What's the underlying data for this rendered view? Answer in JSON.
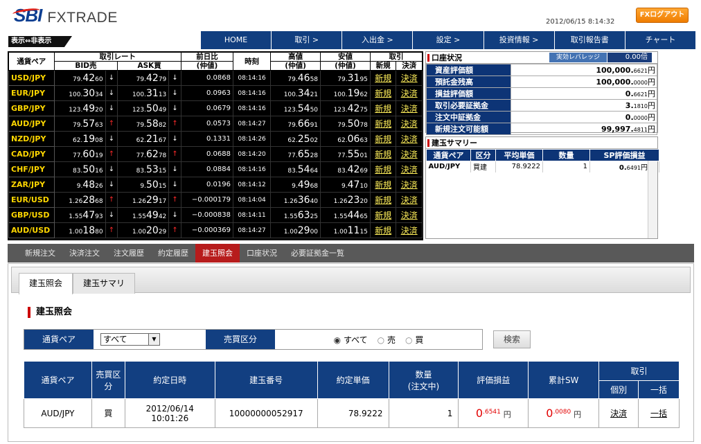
{
  "header": {
    "brand_sbi": "SBI",
    "brand_fx": "FXTRADE",
    "datetime": "2012/06/15 8:14:32",
    "logout": "FXログアウト",
    "toggle": "表示⇔非表示"
  },
  "nav": [
    "HOME",
    "取引 >",
    "入出金 >",
    "設定 >",
    "投資情報 >",
    "取引報告書",
    "チャート"
  ],
  "rates": {
    "headers": {
      "pair": "通貨ペア",
      "rate": "取引レート",
      "bid": "BID売",
      "ask": "ASK買",
      "change": "前日比",
      "change_sub": "(仲値)",
      "time": "時刻",
      "high": "高値",
      "high_sub": "(仲値)",
      "low": "安値",
      "low_sub": "(仲値)",
      "trade": "取引",
      "new": "新規",
      "settle": "決済"
    },
    "rows": [
      {
        "pair": "USD/JPY",
        "bid_a": "79.",
        "bid_b": "42",
        "bid_c": "60",
        "bid_dir": "down",
        "ask_a": "79.",
        "ask_b": "42",
        "ask_c": "79",
        "ask_dir": "down",
        "change": "0.0868",
        "time": "08:14:16",
        "high_a": "79.",
        "high_b": "46",
        "high_c": "58",
        "low_a": "79.",
        "low_b": "31",
        "low_c": "95",
        "new": "新規",
        "settle": "決済"
      },
      {
        "pair": "EUR/JPY",
        "bid_a": "100.",
        "bid_b": "30",
        "bid_c": "34",
        "bid_dir": "down",
        "ask_a": "100.",
        "ask_b": "31",
        "ask_c": "13",
        "ask_dir": "down",
        "change": "0.0963",
        "time": "08:14:16",
        "high_a": "100.",
        "high_b": "34",
        "high_c": "21",
        "low_a": "100.",
        "low_b": "19",
        "low_c": "62",
        "new": "新規",
        "settle": "決済"
      },
      {
        "pair": "GBP/JPY",
        "bid_a": "123.",
        "bid_b": "49",
        "bid_c": "20",
        "bid_dir": "down",
        "ask_a": "123.",
        "ask_b": "50",
        "ask_c": "49",
        "ask_dir": "down",
        "change": "0.0679",
        "time": "08:14:16",
        "high_a": "123.",
        "high_b": "54",
        "high_c": "50",
        "low_a": "123.",
        "low_b": "42",
        "low_c": "75",
        "new": "新規",
        "settle": "決済"
      },
      {
        "pair": "AUD/JPY",
        "bid_a": "79.",
        "bid_b": "57",
        "bid_c": "63",
        "bid_dir": "up",
        "ask_a": "79.",
        "ask_b": "58",
        "ask_c": "82",
        "ask_dir": "up",
        "change": "0.0573",
        "time": "08:14:27",
        "high_a": "79.",
        "high_b": "66",
        "high_c": "91",
        "low_a": "79.",
        "low_b": "50",
        "low_c": "78",
        "new": "新規",
        "settle": "決済"
      },
      {
        "pair": "NZD/JPY",
        "bid_a": "62.",
        "bid_b": "19",
        "bid_c": "08",
        "bid_dir": "down",
        "ask_a": "62.",
        "ask_b": "21",
        "ask_c": "67",
        "ask_dir": "down",
        "change": "0.1331",
        "time": "08:14:26",
        "high_a": "62.",
        "high_b": "25",
        "high_c": "02",
        "low_a": "62.",
        "low_b": "06",
        "low_c": "63",
        "new": "新規",
        "settle": "決済"
      },
      {
        "pair": "CAD/JPY",
        "bid_a": "77.",
        "bid_b": "60",
        "bid_c": "19",
        "bid_dir": "up",
        "ask_a": "77.",
        "ask_b": "62",
        "ask_c": "78",
        "ask_dir": "up",
        "change": "0.0688",
        "time": "08:14:20",
        "high_a": "77.",
        "high_b": "65",
        "high_c": "28",
        "low_a": "77.",
        "low_b": "55",
        "low_c": "01",
        "new": "新規",
        "settle": "決済"
      },
      {
        "pair": "CHF/JPY",
        "bid_a": "83.",
        "bid_b": "50",
        "bid_c": "16",
        "bid_dir": "down",
        "ask_a": "83.",
        "ask_b": "53",
        "ask_c": "15",
        "ask_dir": "down",
        "change": "0.0884",
        "time": "08:14:16",
        "high_a": "83.",
        "high_b": "54",
        "high_c": "64",
        "low_a": "83.",
        "low_b": "42",
        "low_c": "69",
        "new": "新規",
        "settle": "決済"
      },
      {
        "pair": "ZAR/JPY",
        "bid_a": "9.",
        "bid_b": "48",
        "bid_c": "26",
        "bid_dir": "down",
        "ask_a": "9.",
        "ask_b": "50",
        "ask_c": "15",
        "ask_dir": "down",
        "change": "0.0196",
        "time": "08:14:12",
        "high_a": "9.",
        "high_b": "49",
        "high_c": "68",
        "low_a": "9.",
        "low_b": "47",
        "low_c": "10",
        "new": "新規",
        "settle": "決済"
      },
      {
        "pair": "EUR/USD",
        "bid_a": "1.26",
        "bid_b": "28",
        "bid_c": "68",
        "bid_dir": "up",
        "ask_a": "1.26",
        "ask_b": "29",
        "ask_c": "17",
        "ask_dir": "up",
        "change": "−0.000179",
        "time": "08:14:04",
        "high_a": "1.26",
        "high_b": "36",
        "high_c": "40",
        "low_a": "1.26",
        "low_b": "23",
        "low_c": "20",
        "new": "新規",
        "settle": "決済"
      },
      {
        "pair": "GBP/USD",
        "bid_a": "1.55",
        "bid_b": "47",
        "bid_c": "93",
        "bid_dir": "down",
        "ask_a": "1.55",
        "ask_b": "49",
        "ask_c": "42",
        "ask_dir": "down",
        "change": "−0.000838",
        "time": "08:14:11",
        "high_a": "1.55",
        "high_b": "63",
        "high_c": "25",
        "low_a": "1.55",
        "low_b": "44",
        "low_c": "65",
        "new": "新規",
        "settle": "決済"
      },
      {
        "pair": "AUD/USD",
        "bid_a": "1.00",
        "bid_b": "18",
        "bid_c": "80",
        "bid_dir": "up",
        "ask_a": "1.00",
        "ask_b": "20",
        "ask_c": "29",
        "ask_dir": "up",
        "change": "−0.000369",
        "time": "08:14:27",
        "high_a": "1.00",
        "high_b": "29",
        "high_c": "00",
        "low_a": "1.00",
        "low_b": "11",
        "low_c": "15",
        "new": "新規",
        "settle": "決済"
      }
    ]
  },
  "account": {
    "title": "口座状況",
    "leverage_label": "実効レバレッジ",
    "leverage": "0.00倍",
    "rows": [
      {
        "k": "資産評価額",
        "v": "100,000.",
        "s": "6621",
        "u": "円"
      },
      {
        "k": "預託金残高",
        "v": "100,000.",
        "s": "0000",
        "u": "円"
      },
      {
        "k": "損益評価額",
        "v": "0.",
        "s": "6621",
        "u": "円"
      },
      {
        "k": "取引必要証拠金",
        "v": "3.",
        "s": "1810",
        "u": "円"
      },
      {
        "k": "注文中証拠金",
        "v": "0.",
        "s": "0000",
        "u": "円"
      },
      {
        "k": "新規注文可能額",
        "v": "99,997.",
        "s": "4811",
        "u": "円"
      }
    ]
  },
  "summary": {
    "title": "建玉サマリー",
    "headers": [
      "通貨ペア",
      "区分",
      "平均単価",
      "数量",
      "SP評価損益"
    ],
    "row": {
      "pair": "AUD/JPY",
      "side": "買建",
      "avg": "78.9222",
      "qty": "1",
      "pl_a": "0.",
      "pl_b": "6491",
      "pl_u": "円"
    }
  },
  "tabs": [
    "新規注文",
    "決済注文",
    "注文履歴",
    "約定履歴",
    "建玉照会",
    "口座状況",
    "必要証拠金一覧"
  ],
  "subtabs": [
    "建玉照会",
    "建玉サマリ"
  ],
  "section_title": "建玉照会",
  "filter": {
    "pair_label": "通貨ペア",
    "pair_value": "すべて",
    "side_label": "売買区分",
    "opt_all": "すべて",
    "opt_sell": "売",
    "opt_buy": "買",
    "search": "検索"
  },
  "positions": {
    "headers": {
      "pair": "通貨ペア",
      "side": "売買区分",
      "date": "約定日時",
      "no": "建玉番号",
      "price": "約定単価",
      "qty": "数量",
      "qty_sub": "(注文中)",
      "pl": "評価損益",
      "sw": "累計SW",
      "trade": "取引",
      "each": "個別",
      "bulk": "一括"
    },
    "row": {
      "pair": "AUD/JPY",
      "side": "買",
      "date": "2012/06/14",
      "time": "10:01:26",
      "no": "10000000052917",
      "price": "78.9222",
      "qty": "1",
      "pl_a": "0",
      "pl_b": ".6541",
      "sw_a": "0",
      "sw_b": ".0080",
      "yen": "円",
      "settle": "決済",
      "bulk": "一括"
    }
  }
}
